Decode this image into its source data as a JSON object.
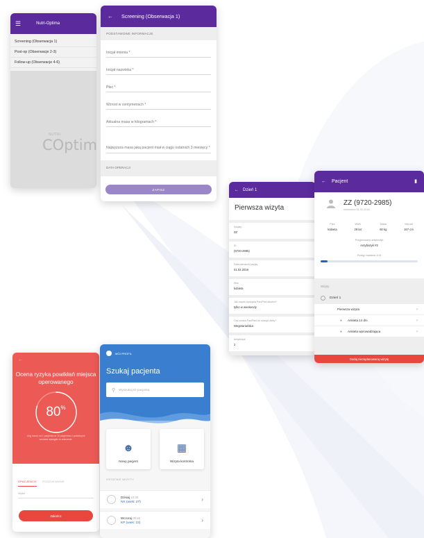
{
  "drawer": {
    "app_title": "Nutri-Optima",
    "menu_icon": "hamburger-icon",
    "items": [
      "Screening (Obserwacja 1)",
      "Post-op (Obserwacje 2-3)",
      "Follow-up (Obserwacje 4-6)"
    ],
    "logo_small": "NUTRI",
    "logo_big": "Optima"
  },
  "screening": {
    "title": "Screening (Obserwacja 1)",
    "section": "PODSTAWOWE INFORMACJE",
    "fields": [
      "Inicjał imienia *",
      "Inicjał nazwiska *",
      "Płeć *",
      "Wzrost w centymetrach *",
      "Aktualna masa w kilogramach *",
      "Najwyższa masa jaką pacjent miał w ciągu ostatnich 3 miesięcy *"
    ],
    "section2": "DATA OPERACJI",
    "save": "ZAPISZ"
  },
  "day": {
    "header": "Dzień 1",
    "title": "Pierwsza wizyta",
    "blocks": [
      {
        "label": "Inicjały",
        "value": "ZZ"
      },
      {
        "label": "ID",
        "value": "(9720-2985)"
      },
      {
        "label": "Data pierwszej wizyty",
        "value": "01.02.2018"
      },
      {
        "label": "Płeć",
        "value": "kobieta"
      },
      {
        "label": "Jak często spożywa Pan/Pani alkohol?",
        "value": "tylko w weekendy"
      },
      {
        "label": "Czy uważa Pan/Pani że stosuje dietę?",
        "value": "Wegetariańska"
      },
      {
        "label": "Antybiotyk",
        "value": "2"
      }
    ]
  },
  "patient": {
    "header": "Pacjent",
    "name": "ZZ (9720-2985)",
    "sub": "utworzono 01.02.2018",
    "stats": [
      {
        "label": "Płeć",
        "value": "kobieta"
      },
      {
        "label": "Wiek",
        "value": "29 lat"
      },
      {
        "label": "Masa",
        "value": "60 kg"
      },
      {
        "label": "Wzrost",
        "value": "167 cm"
      }
    ],
    "antibiotic_label": "Przyjmowany antybiotyk",
    "antibiotic_value": "Antybiotyk #2",
    "progress_label": "Postęp badania 1/14",
    "progress_fraction": 0.07,
    "visits_label": "Wizyty",
    "day_label": "Dzień 1",
    "visits": [
      "Pierwsza wizyta",
      "Ankieta 14 dni",
      "Ankieta wprowadzająca"
    ],
    "red_button": "Dodaj niezaplanowaną wizytę"
  },
  "risk": {
    "title": "Ocena ryzyka powikłań miejsca operowanego",
    "percent": "80",
    "percent_sign": "%",
    "percent_value": 80,
    "description": "Użyj wzoru na 1 pacjenta na 10 pacjentów z podobnymi cechami wystąpiło to zdarzenie.",
    "tab_active": "OPACJENCIE",
    "tab_inactive": "POSZUKIWANE",
    "input_placeholder": "Wpisz",
    "button": "Zakończ"
  },
  "search": {
    "profile": "MÓJ PROFIL",
    "title": "Szukaj pacjenta",
    "placeholder": "Wyszukaj ID pacjenta",
    "tiles": [
      {
        "label": "Nowy pacjent",
        "icon": "new-patient-icon"
      },
      {
        "label": "Wizyta kontrolna",
        "icon": "calendar-icon"
      }
    ],
    "recent_label": "OSTATNIE WIZYTY",
    "recent": [
      {
        "when": "Dzisiaj",
        "time": "10:30",
        "patient": "NK (wiek: 27)"
      },
      {
        "when": "Wczoraj",
        "time": "09:45",
        "patient": "KP (wiek: 23)"
      }
    ]
  },
  "colors": {
    "purple": "#5b2a9c",
    "blue": "#3a7fcf",
    "red": "#e8473d"
  }
}
